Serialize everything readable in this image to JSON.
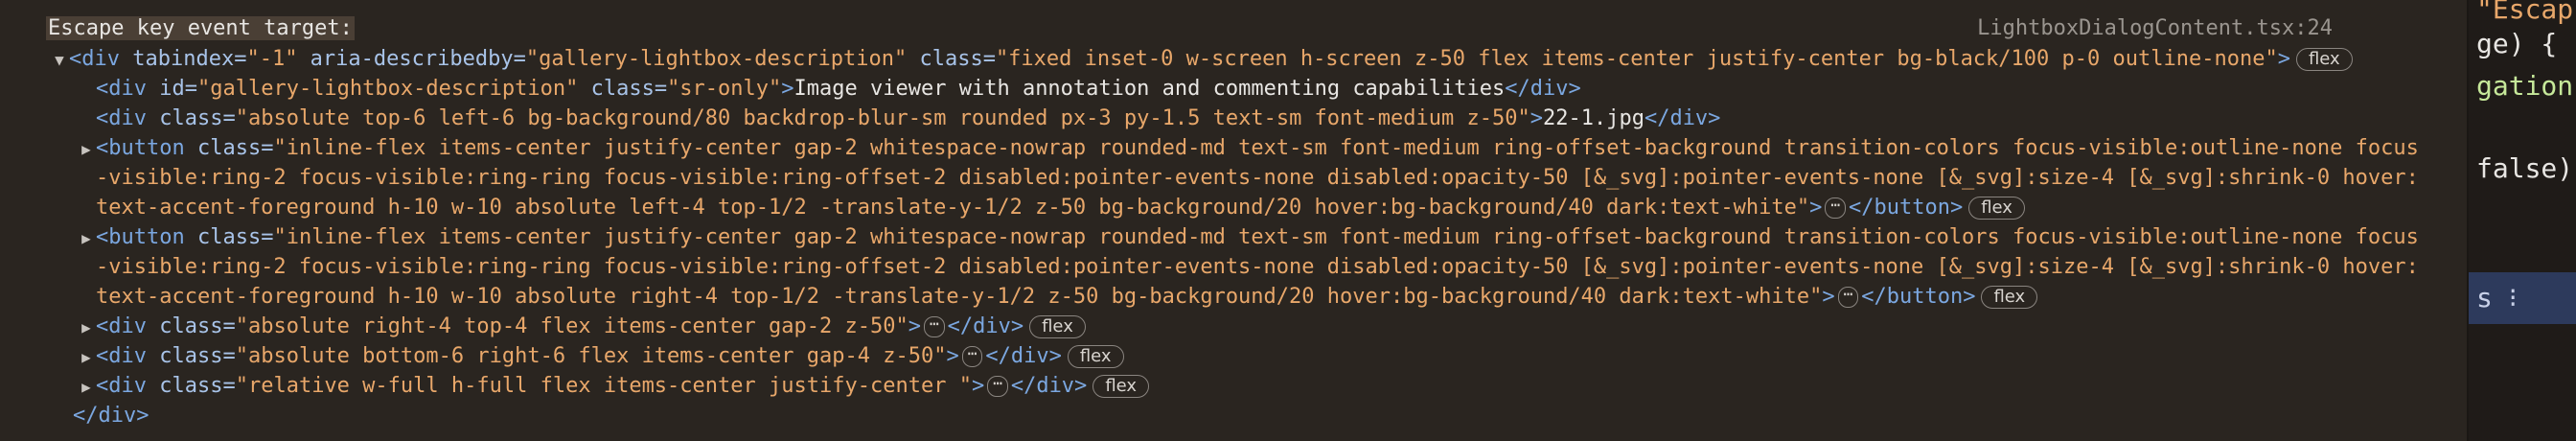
{
  "heading": "Escape key event target:",
  "source": "LightboxDialogContent.tsx:24",
  "badge_label": "flex",
  "ellipsis_label": "⋯",
  "arrow_open": "▼",
  "arrow_closed": "▶",
  "lines": {
    "l1": {
      "open": "<div ",
      "a1": "tabindex=",
      "v1": "\"-1\"",
      "a2": " aria-describedby=",
      "v2": "\"gallery-lightbox-description\"",
      "a3": " class=",
      "v3": "\"fixed inset-0 w-screen h-screen z-50 flex items-center justify-center bg-black/100 p-0 outline-none\"",
      "close": ">"
    },
    "l2": {
      "open": "<div ",
      "a1": "id=",
      "v1": "\"gallery-lightbox-description\"",
      "a2": " class=",
      "v2": "\"sr-only\"",
      "mid": ">",
      "text": "Image viewer with annotation and commenting capabilities",
      "close": "</div>"
    },
    "l3": {
      "open": "<div ",
      "a1": "class=",
      "v1": "\"absolute top-6 left-6 bg-background/80 backdrop-blur-sm rounded px-3 py-1.5 text-sm font-medium z-50\"",
      "mid": ">",
      "text": "22-1.jpg",
      "close": "</div>"
    },
    "l4a": {
      "open": "<button ",
      "a1": "class=",
      "v1": "\"inline-flex items-center justify-center gap-2 whitespace-nowrap rounded-md text-sm font-medium ring-offset-background transition-colors focus-visible:outline-none focus"
    },
    "l4b": {
      "v1": "-visible:ring-2 focus-visible:ring-ring focus-visible:ring-offset-2 disabled:pointer-events-none disabled:opacity-50 [&_svg]:pointer-events-none [&_svg]:size-4 [&_svg]:shrink-0 hover:"
    },
    "l4c": {
      "v1": "text-accent-foreground h-10 w-10 absolute left-4 top-1/2 -translate-y-1/2 z-50 bg-background/20 hover:bg-background/40 dark:text-white\"",
      "mid": ">",
      "close": "</button>"
    },
    "l5a": {
      "open": "<button ",
      "a1": "class=",
      "v1": "\"inline-flex items-center justify-center gap-2 whitespace-nowrap rounded-md text-sm font-medium ring-offset-background transition-colors focus-visible:outline-none focus"
    },
    "l5b": {
      "v1": "-visible:ring-2 focus-visible:ring-ring focus-visible:ring-offset-2 disabled:pointer-events-none disabled:opacity-50 [&_svg]:pointer-events-none [&_svg]:size-4 [&_svg]:shrink-0 hover:"
    },
    "l5c": {
      "v1": "text-accent-foreground h-10 w-10 absolute right-4 top-1/2 -translate-y-1/2 z-50 bg-background/20 hover:bg-background/40 dark:text-white\"",
      "mid": ">",
      "close": "</button>"
    },
    "l6": {
      "open": "<div ",
      "a1": "class=",
      "v1": "\"absolute right-4 top-4 flex items-center gap-2 z-50\"",
      "mid": ">",
      "close": "</div>"
    },
    "l7": {
      "open": "<div ",
      "a1": "class=",
      "v1": "\"absolute bottom-6 right-6 flex items-center gap-4 z-50\"",
      "mid": ">",
      "close": "</div>"
    },
    "l8": {
      "open": "<div ",
      "a1": "class=",
      "v1": "\"relative w-full h-full flex items-center justify-center \"",
      "mid": ">",
      "close": "</div>"
    },
    "l9": {
      "close": "</div>"
    }
  },
  "right_pane": {
    "r1": "\"Escap",
    "r2": "ge) {",
    "r3": "gation(",
    "r4": "false);",
    "r5": "s ⁝"
  }
}
